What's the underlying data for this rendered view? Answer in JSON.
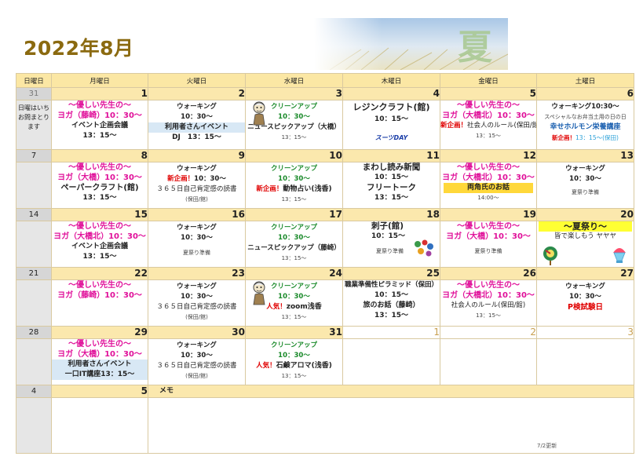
{
  "header": {
    "title": "2022年8月",
    "banner_kanji": "夏"
  },
  "weekdays": [
    "日曜日",
    "月曜日",
    "火曜日",
    "水曜日",
    "木曜日",
    "金曜日",
    "土曜日"
  ],
  "weeks": [
    {
      "dates": [
        "31",
        "1",
        "2",
        "3",
        "4",
        "5",
        "6"
      ],
      "sun": [
        "日曜はいち",
        "お問まとり",
        "ます"
      ],
      "mon": [
        "～優しい先生の～",
        "ヨガ（藤崎）10：30～",
        "イベント企画会議",
        "13：15～"
      ],
      "tue": [
        "ウォーキング",
        "10：30～",
        "利用者さんイベント",
        "DJ　13：15～"
      ],
      "wed": [
        "クリーンアップ",
        "10：30～",
        "ニュースピックアップ（大橋）",
        "13：15～"
      ],
      "thu": [
        "レジンクラフト(館)",
        "10：15～",
        "スーツDAY"
      ],
      "fri": [
        "～優しい先生の～",
        "ヨガ（大橋北）10：30～",
        "新企画！",
        "社会人のルール(保田/館)",
        "13：15～"
      ],
      "sat": [
        "ウォーキング10:30～",
        "スペシャルなお弁当土用の日の日",
        "幸せホルモン栄養講座",
        "新企画！",
        "13：15～(保田)"
      ]
    },
    {
      "dates": [
        "7",
        "8",
        "9",
        "10",
        "11",
        "12",
        "13"
      ],
      "mon": [
        "～優しい先生の～",
        "ヨガ（大橋）10：30～",
        "ペーパークラフト(館)",
        "13：15～"
      ],
      "tue": [
        "ウォーキング",
        "新企画！",
        "10：30～",
        "３６５日自己肯定感の読書",
        "(保田/館)"
      ],
      "wed": [
        "クリーンアップ",
        "10：30～",
        "新企画！",
        "動物占い(浅香)",
        "13：15～"
      ],
      "thu": [
        "まわし読み新聞",
        "10：15～",
        "フリートーク",
        "13：15～"
      ],
      "fri": [
        "～優しい先生の～",
        "ヨガ（大橋北）10：30～",
        "両角氏のお話",
        "14:00～"
      ],
      "sat": [
        "ウォーキング",
        "10：30～",
        "夏祭り準備"
      ]
    },
    {
      "dates": [
        "14",
        "15",
        "16",
        "17",
        "18",
        "19",
        "20"
      ],
      "mon": [
        "～優しい先生の～",
        "ヨガ（大橋北）10：30～",
        "イベント企画会議",
        "13：15～"
      ],
      "tue": [
        "ウォーキング",
        "10：30～",
        "夏祭り準備"
      ],
      "wed": [
        "クリーンアップ",
        "10：30～",
        "ニュースピックアップ（藤崎）",
        "13：15～"
      ],
      "thu": [
        "刺子(館)",
        "10：15～",
        "夏祭り準備"
      ],
      "fri": [
        "～優しい先生の～",
        "ヨガ（大橋）10：30～",
        "夏祭り準備"
      ],
      "sat": [
        "～夏祭り～",
        "皆で楽しもう ヤヤヤ"
      ]
    },
    {
      "dates": [
        "21",
        "22",
        "23",
        "24",
        "25",
        "26",
        "27"
      ],
      "mon": [
        "～優しい先生の～",
        "ヨガ（藤崎）10：30～"
      ],
      "tue": [
        "ウォーキング",
        "10：30～",
        "３６５日自己肯定感の読書",
        "(保田/館)"
      ],
      "wed": [
        "クリーンアップ",
        "10：30～",
        "人気！",
        "zoom浅香",
        "13：15～"
      ],
      "thu": [
        "職業準備性ピラミッド（保田）",
        "10：15～",
        "旅のお話（藤崎）",
        "13：15～"
      ],
      "fri": [
        "～優しい先生の～",
        "ヨガ（大橋北）10：30～",
        "社会人のルール(保田/館)",
        "13：15～"
      ],
      "sat": [
        "ウォーキング",
        "10：30～",
        "P検試験日"
      ]
    },
    {
      "dates": [
        "28",
        "29",
        "30",
        "31",
        "1",
        "2",
        "3"
      ],
      "mon": [
        "～優しい先生の～",
        "ヨガ（大橋）10：30～",
        "利用者さんイベント",
        "一口IT講座13：15～"
      ],
      "tue": [
        "ウォーキング",
        "10：30～",
        "３６５日自己肯定感の読書",
        "(保田/館)"
      ],
      "wed": [
        "クリーンアップ",
        "10：30～",
        "人気！",
        "石鹸アロマ(浅香)",
        "13：15～"
      ]
    },
    {
      "dates": [
        "4",
        "5"
      ],
      "memo_label": "メモ",
      "updated": "7/2更新"
    }
  ]
}
